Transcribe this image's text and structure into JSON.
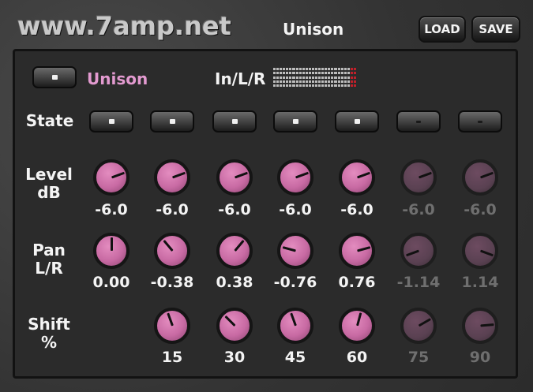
{
  "header": {
    "logo_text": "www.7amp.net",
    "title": "Unison",
    "load_label": "LOAD",
    "save_label": "SAVE"
  },
  "unison": {
    "label": "Unison",
    "label_color": "#e39ad0",
    "enabled": true
  },
  "meter": {
    "label": "In/L/R"
  },
  "rows": {
    "state_label": "State",
    "level_label_line1": "Level",
    "level_label_line2": "dB",
    "pan_label_line1": "Pan",
    "pan_label_line2": "L/R",
    "shift_label_line1": "Shift",
    "shift_label_line2": "%"
  },
  "voices": [
    {
      "state": true,
      "level": "-6.0",
      "pan": "0.00",
      "shift": null,
      "active": true
    },
    {
      "state": true,
      "level": "-6.0",
      "pan": "-0.38",
      "shift": "15",
      "active": true
    },
    {
      "state": true,
      "level": "-6.0",
      "pan": "0.38",
      "shift": "30",
      "active": true
    },
    {
      "state": true,
      "level": "-6.0",
      "pan": "-0.76",
      "shift": "45",
      "active": true
    },
    {
      "state": true,
      "level": "-6.0",
      "pan": "0.76",
      "shift": "60",
      "active": true
    },
    {
      "state": false,
      "level": "-6.0",
      "pan": "-1.14",
      "shift": "75",
      "active": false
    },
    {
      "state": false,
      "level": "-6.0",
      "pan": "1.14",
      "shift": "90",
      "active": false
    }
  ],
  "colors": {
    "knob_active": "#c86aa3",
    "knob_inactive": "#5a4152",
    "text": "#f4f4f4",
    "text_inactive": "#6f6f6f"
  }
}
